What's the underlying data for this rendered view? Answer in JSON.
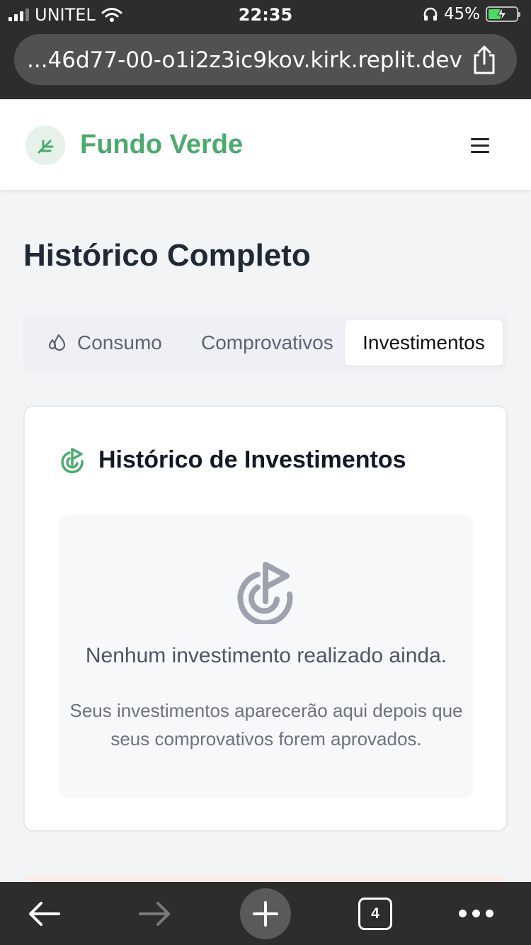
{
  "status_bar": {
    "carrier": "UNITEL",
    "time": "22:35",
    "battery_percent": "45%",
    "battery_level": 0.45,
    "icons": [
      "signal-icon",
      "wifi-icon",
      "headphones-icon",
      "battery-charging-icon"
    ]
  },
  "browser": {
    "url": "...46d77-00-o1i2z3ic9kov.kirk.replit.dev",
    "tabs_count": "4",
    "icons": [
      "share-icon",
      "back-arrow-icon",
      "forward-arrow-icon",
      "plus-icon",
      "tabs-icon",
      "more-icon"
    ]
  },
  "header": {
    "brand": "Fundo Verde",
    "logo_icon": "sprout-icon",
    "menu_icon": "hamburger-icon"
  },
  "page": {
    "title": "Histórico Completo",
    "tabs": [
      {
        "label": "Consumo",
        "icon": "droplets-icon",
        "active": false
      },
      {
        "label": "Comprovativos",
        "active": false
      },
      {
        "label": "Investimentos",
        "active": true
      }
    ]
  },
  "card": {
    "title": "Histórico de Investimentos",
    "title_icon": "target-arrow-icon",
    "empty": {
      "icon": "target-arrow-icon",
      "title": "Nenhum investimento realizado ainda.",
      "description": "Seus investimentos aparecerão aqui depois que seus comprovativos forem aprovados."
    }
  },
  "colors": {
    "brand_green": "#4caa6d",
    "browser_chrome": "#2d2d2d",
    "page_bg": "#f3f4f6"
  }
}
